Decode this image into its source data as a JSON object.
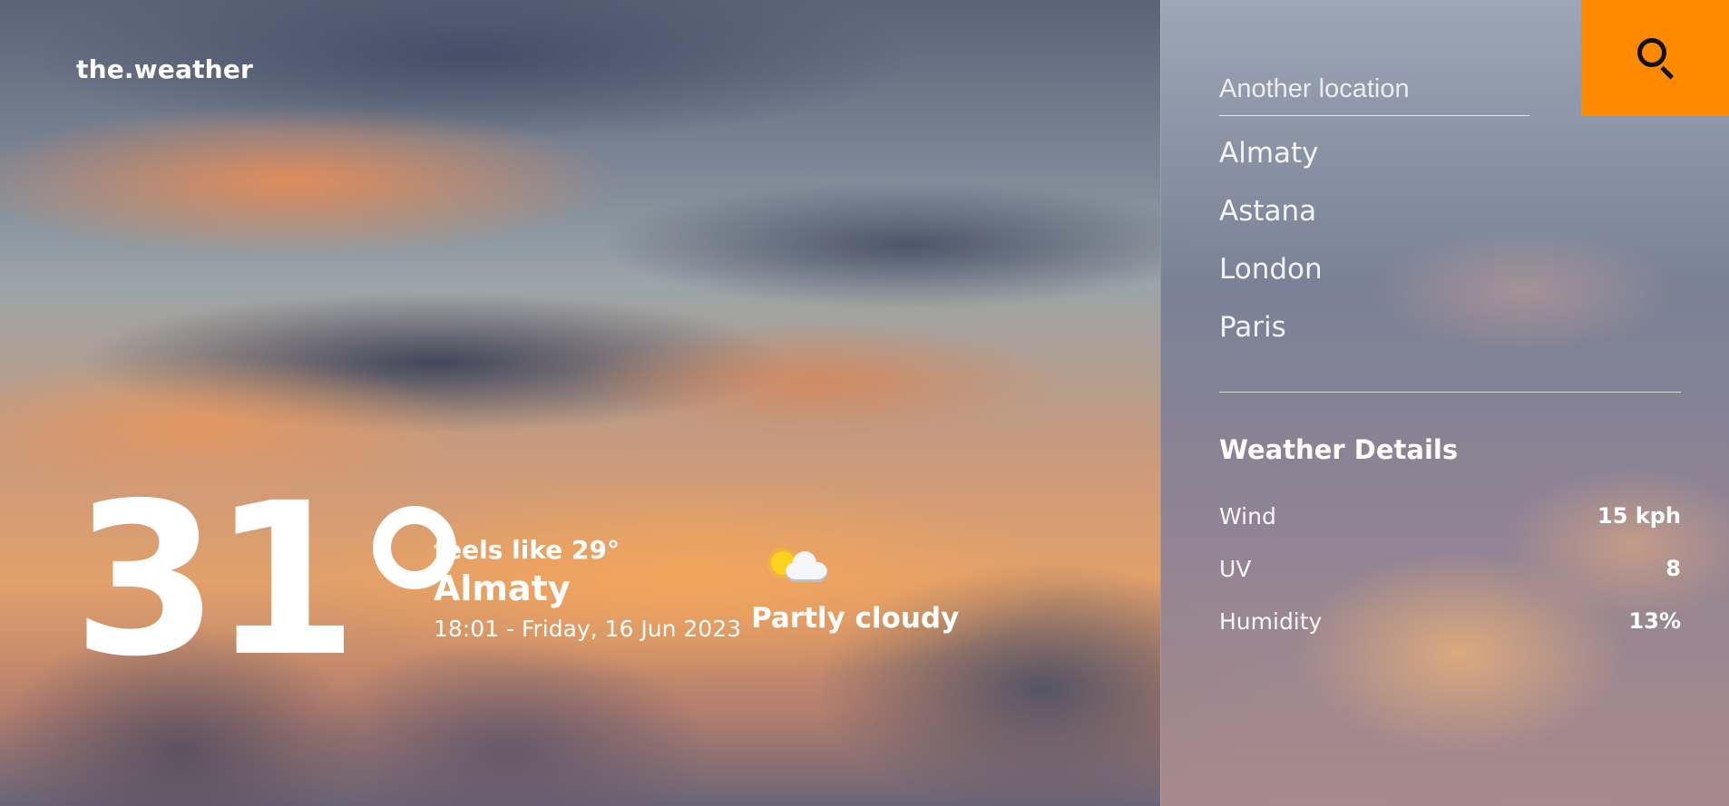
{
  "brand": "the.weather",
  "current": {
    "temperature": "31",
    "degree_symbol": "°",
    "feels_like": "feels like 29°",
    "city": "Almaty",
    "datetime": "18:01 - Friday, 16 Jun 2023",
    "condition": "Partly cloudy",
    "condition_icon": "partly-cloudy-icon"
  },
  "search": {
    "placeholder": "Another location",
    "value": "",
    "button_icon": "search-icon",
    "button_color": "#ff8a00"
  },
  "locations": [
    "Almaty",
    "Astana",
    "London",
    "Paris"
  ],
  "details": {
    "title": "Weather Details",
    "rows": [
      {
        "label": "Wind",
        "value": "15 kph"
      },
      {
        "label": "UV",
        "value": "8"
      },
      {
        "label": "Humidity",
        "value": "13%"
      }
    ]
  }
}
